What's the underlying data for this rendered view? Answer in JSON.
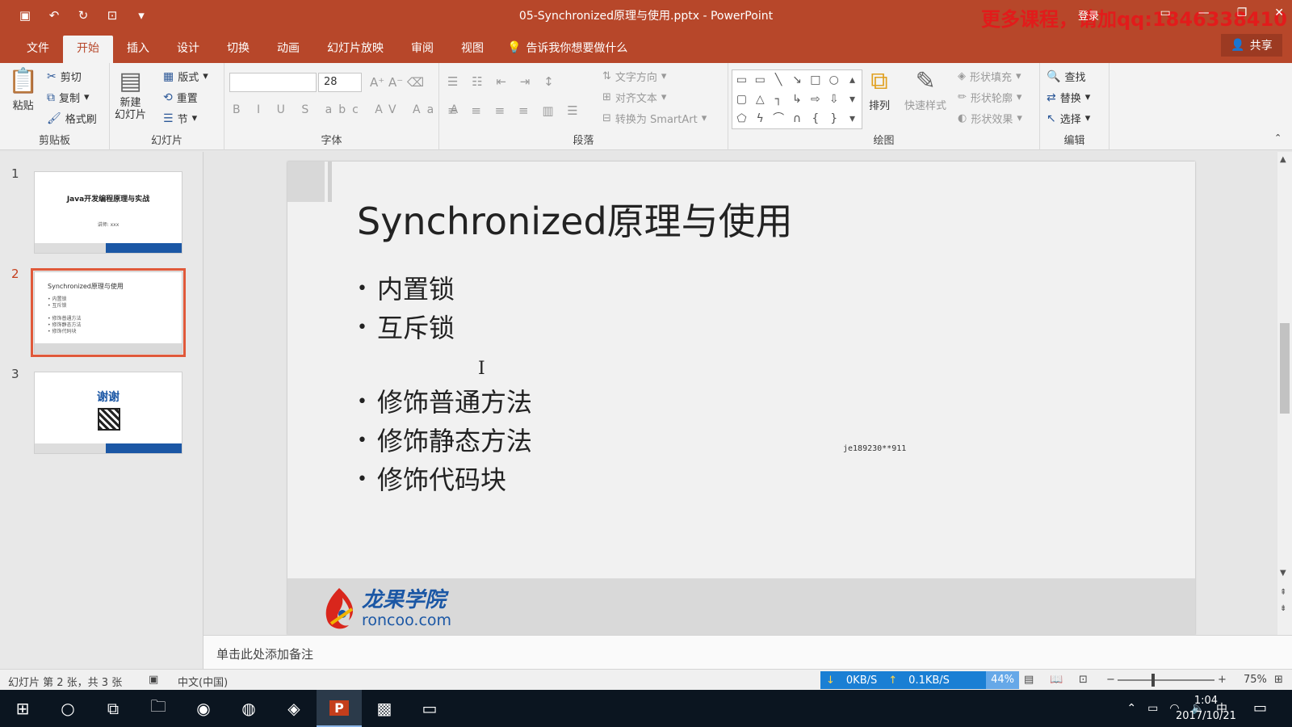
{
  "window": {
    "title": "05-Synchronized原理与使用.pptx  -  PowerPoint",
    "watermark": "更多课程，请加qq:1846338410",
    "login": "登录",
    "controls": [
      "▭",
      "—",
      "❐",
      "✕"
    ]
  },
  "tabs": [
    {
      "label": "文件",
      "active": false
    },
    {
      "label": "开始",
      "active": true
    },
    {
      "label": "插入",
      "active": false
    },
    {
      "label": "设计",
      "active": false
    },
    {
      "label": "切换",
      "active": false
    },
    {
      "label": "动画",
      "active": false
    },
    {
      "label": "幻灯片放映",
      "active": false
    },
    {
      "label": "审阅",
      "active": false
    },
    {
      "label": "视图",
      "active": false
    }
  ],
  "tell_me": "告诉我你想要做什么",
  "share": "共享",
  "ribbon": {
    "clipboard": {
      "label": "剪贴板",
      "paste": "粘贴",
      "cut": "剪切",
      "copy": "复制",
      "format_painter": "格式刷"
    },
    "slides": {
      "label": "幻灯片",
      "new_slide": "新建\n幻灯片",
      "layout": "版式",
      "reset": "重置",
      "section": "节"
    },
    "font": {
      "label": "字体",
      "name": "",
      "size": "28"
    },
    "paragraph": {
      "label": "段落",
      "text_direction": "文字方向",
      "align_text": "对齐文本",
      "convert_smartart": "转换为 SmartArt"
    },
    "drawing": {
      "label": "绘图",
      "arrange": "排列",
      "quick_styles": "快速样式",
      "shape_fill": "形状填充",
      "shape_outline": "形状轮廓",
      "shape_effects": "形状效果"
    },
    "editing": {
      "label": "编辑",
      "find": "查找",
      "replace": "替换",
      "select": "选择"
    }
  },
  "thumbnails": [
    {
      "num": "1",
      "title": "Java开发编程原理与实战",
      "sub": "讲师: xxx"
    },
    {
      "num": "2",
      "title": "Synchronized原理与使用",
      "lines": "• 内置锁\n• 互斥锁\n\n• 修饰普通方法\n• 修饰静态方法\n• 修饰代码块"
    },
    {
      "num": "3",
      "title": "谢谢"
    }
  ],
  "slide": {
    "title": "Synchronized原理与使用",
    "bullets_top": [
      "内置锁",
      "互斥锁"
    ],
    "bullets_bottom": [
      "修饰普通方法",
      "修饰静态方法",
      "修饰代码块"
    ],
    "stamp": "je189230**911",
    "logo_name": "龙果学院",
    "logo_url": "roncoo.com"
  },
  "notes_placeholder": "单击此处添加备注",
  "status": {
    "slide_info": "幻灯片 第 2 张，共 3 张",
    "language": "中文(中国)",
    "download": "0KB/S",
    "upload": "0.1KB/S",
    "cpu": "44%",
    "zoom": "75%"
  },
  "taskbar": {
    "time": "1:04",
    "date": "2017/10/21",
    "ime": "中"
  }
}
